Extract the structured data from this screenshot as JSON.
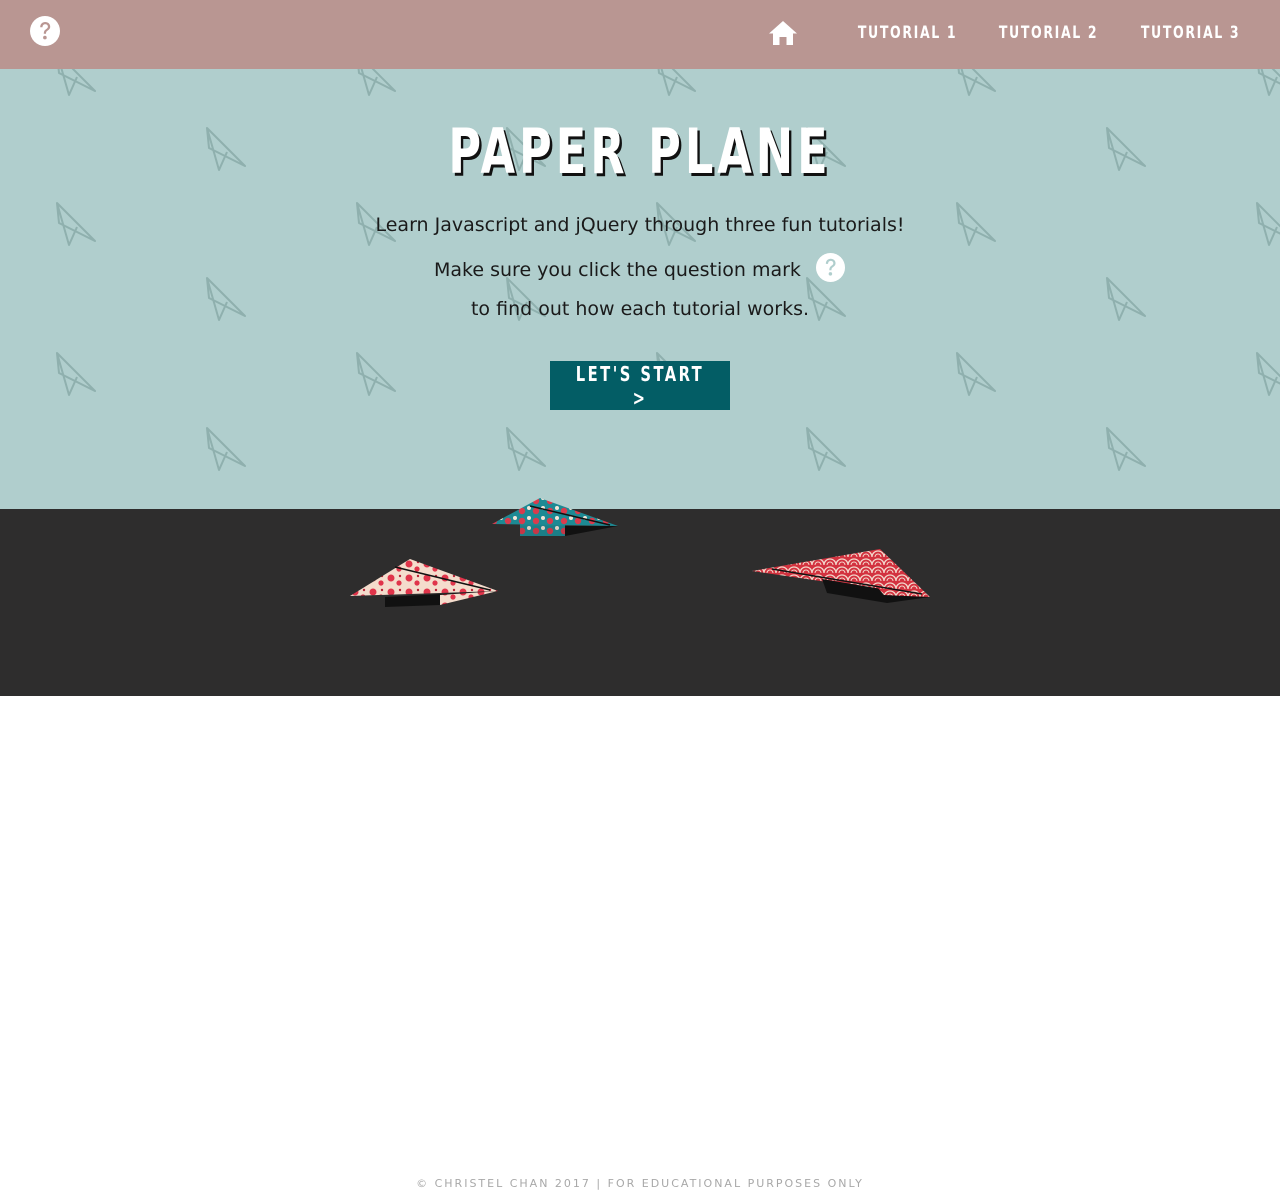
{
  "header": {
    "help_icon": "question-circle-icon",
    "home_icon": "home-icon",
    "nav": [
      {
        "label": "TUTORIAL 1"
      },
      {
        "label": "TUTORIAL 2"
      },
      {
        "label": "TUTORIAL 3"
      }
    ]
  },
  "hero": {
    "title": "PAPER PLANE",
    "line1": "Learn Javascript and jQuery through three fun tutorials!",
    "line2": "Make sure you click the question mark",
    "line3": "to find out how each tutorial works.",
    "cta": "LET'S START >"
  },
  "footer": {
    "text": "© CHRISTEL CHAN 2017 | FOR EDUCATIONAL PURPOSES ONLY"
  },
  "colors": {
    "header_bg": "#b99692",
    "hero_bg": "#b0cecd",
    "cta_bg": "#035d65",
    "ground_bg": "#2e2d2d"
  }
}
